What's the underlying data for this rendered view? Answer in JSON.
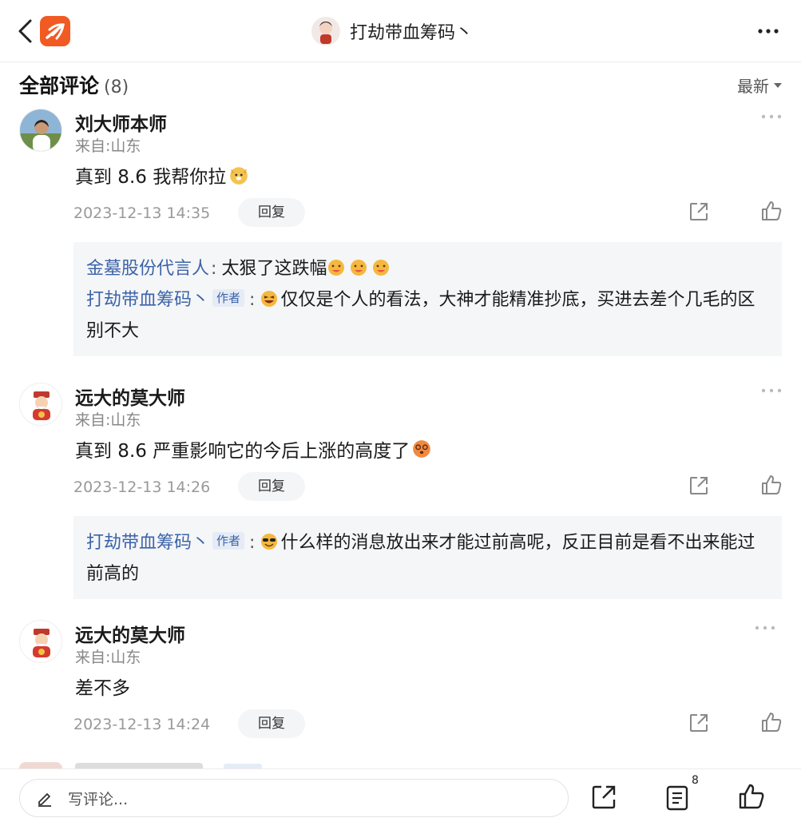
{
  "header": {
    "author_name": "打劫带血筹码丶"
  },
  "section": {
    "title": "全部评论",
    "count": "(8)",
    "sort_label": "最新"
  },
  "comments": [
    {
      "user": "刘大师本师",
      "location": "来自:山东",
      "text": "真到 8.6 我帮你拉",
      "time": "2023-12-13 14:35",
      "reply_label": "回复",
      "replies": [
        {
          "name": "金墓股份代言人",
          "text": "太狠了这跌幅"
        },
        {
          "name": "打劫带血筹码丶",
          "tag": "作者",
          "text": "仅仅是个人的看法，大神才能精准抄底，买进去差个几毛的区别不大"
        }
      ]
    },
    {
      "user": "远大的莫大师",
      "location": "来自:山东",
      "text": "真到 8.6 严重影响它的今后上涨的高度了",
      "time": "2023-12-13 14:26",
      "reply_label": "回复",
      "replies": [
        {
          "name": "打劫带血筹码丶",
          "tag": "作者",
          "text": "什么样的消息放出来才能过前高呢，反正目前是看不出来能过前高的"
        }
      ]
    },
    {
      "user": "远大的莫大师",
      "location": "来自:山东",
      "text": "差不多",
      "time": "2023-12-13 14:24",
      "reply_label": "回复",
      "replies": []
    }
  ],
  "bottom": {
    "input_placeholder": "写评论...",
    "comment_count": "8"
  },
  "colors": {
    "brand": "#f15a22",
    "link": "#3b63a8",
    "reply_bg": "#f5f6f8"
  }
}
